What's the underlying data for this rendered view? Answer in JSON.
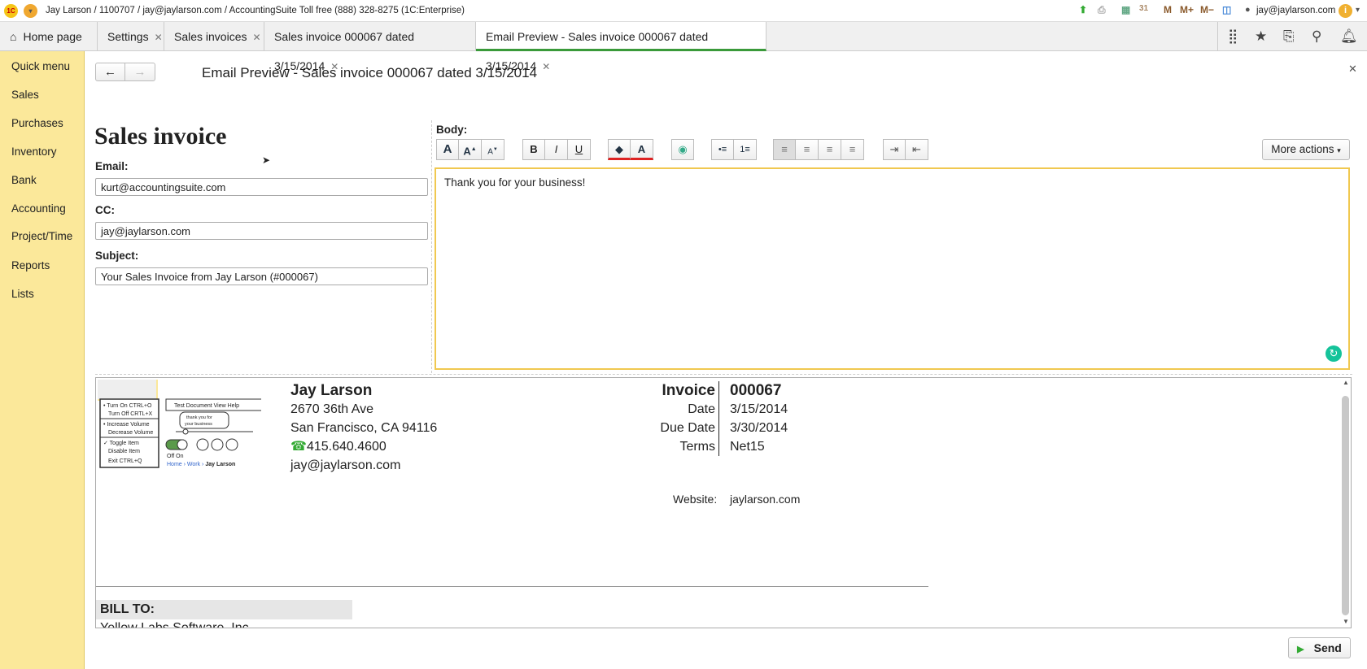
{
  "titlebar": {
    "text": "Jay Larson / 1100707 / jay@jaylarson.com / AccountingSuite Toll free (888) 328-8275   (1C:Enterprise)",
    "user": "jay@jaylarson.com",
    "m": "M",
    "m_plus": "M+",
    "m_minus": "M−",
    "logo": "1C"
  },
  "tabs": [
    {
      "label": "Home page"
    },
    {
      "label": "Settings"
    },
    {
      "label": "Sales invoices"
    },
    {
      "label": "Sales invoice 000067 dated 3/15/2014"
    },
    {
      "label": "Email Preview - Sales invoice 000067 dated 3/15/2014",
      "active": true
    }
  ],
  "sidebar": {
    "items": [
      "Quick menu",
      "Sales",
      "Purchases",
      "Inventory",
      "Bank",
      "Accounting",
      "Project/Time",
      "Reports",
      "Lists"
    ]
  },
  "form": {
    "title": "Email Preview - Sales invoice 000067 dated 3/15/2014",
    "heading": "Sales invoice",
    "email_label": "Email:",
    "email": "kurt@accountingsuite.com",
    "cc_label": "CC:",
    "cc": "jay@jaylarson.com",
    "subject_label": "Subject:",
    "subject": "Your Sales Invoice from Jay Larson (#000067)",
    "body_label": "Body:",
    "body": "Thank you for your business!",
    "more_actions": "More actions",
    "send": "Send"
  },
  "invoice": {
    "company": "Jay Larson",
    "address1": "2670 36th Ave",
    "address2": "San Francisco, CA 94116",
    "phone": "415.640.4600",
    "email": "jay@jaylarson.com",
    "invoice_label": "Invoice",
    "invoice_no": "000067",
    "date_label": "Date",
    "date": "3/15/2014",
    "due_label": "Due Date",
    "due": "3/30/2014",
    "terms_label": "Terms",
    "terms": "Net15",
    "website_label": "Website:",
    "website": "jaylarson.com",
    "bill_to": "BILL TO:",
    "bill_to_name": "Yellow Labs Software, Inc."
  },
  "colors": {
    "sidebar": "#fbe89a",
    "active_tab": "#3a9a3a",
    "editor_border": "#f0c850"
  }
}
